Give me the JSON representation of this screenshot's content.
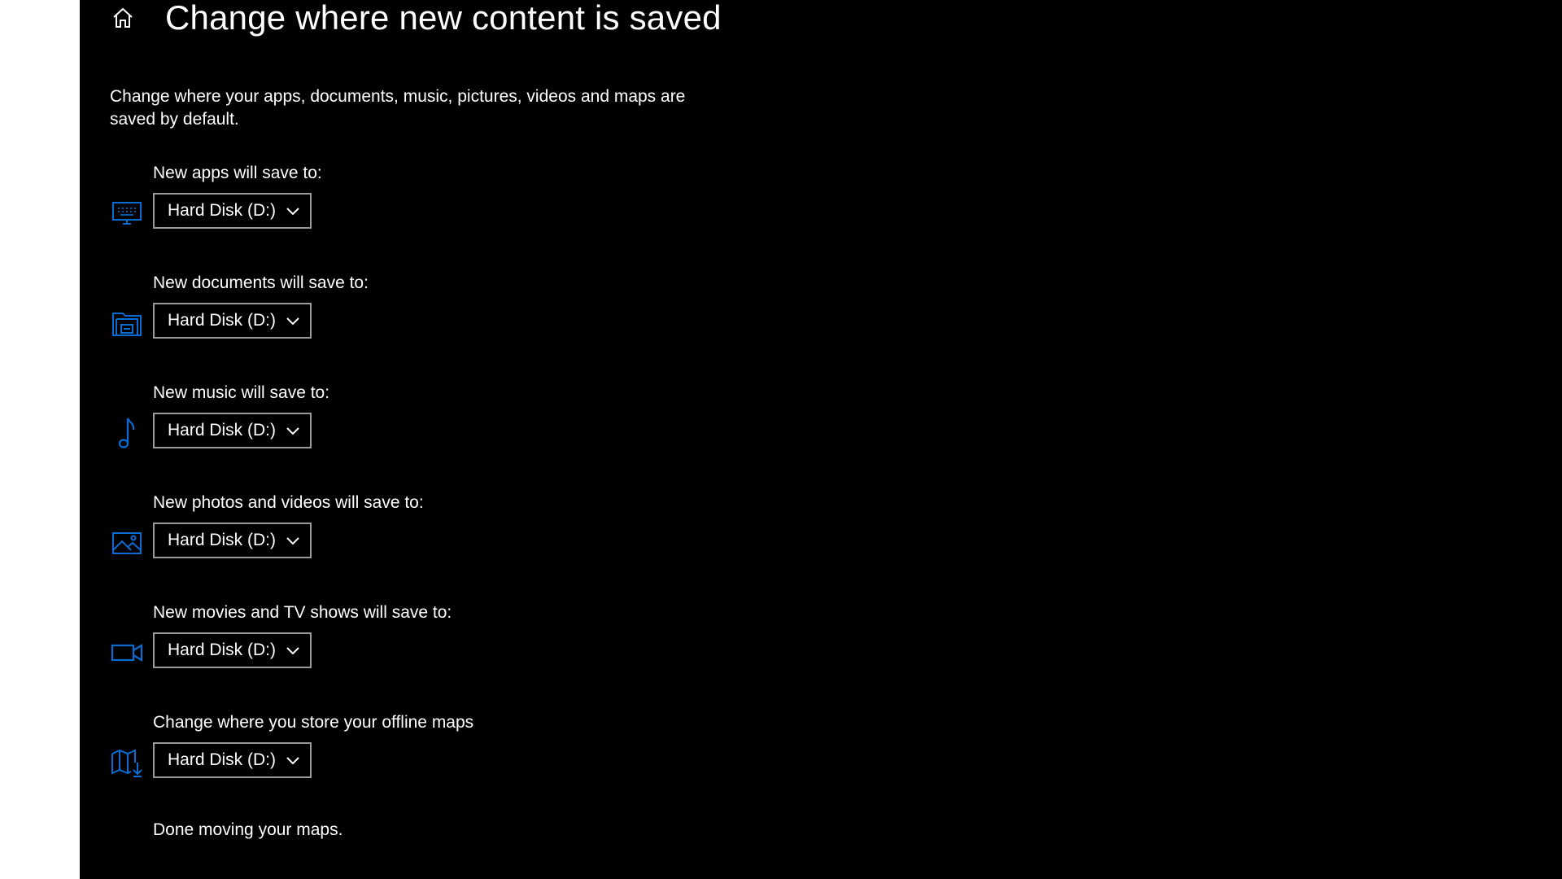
{
  "header": {
    "title": "Change where new content is saved",
    "home_icon": "home-icon"
  },
  "description": "Change where your apps, documents, music, pictures, videos and maps are saved by default.",
  "settings": [
    {
      "label": "New apps will save to:",
      "value": "Hard Disk (D:)",
      "icon": "monitor-keyboard-icon"
    },
    {
      "label": "New documents will save to:",
      "value": "Hard Disk (D:)",
      "icon": "documents-drive-icon"
    },
    {
      "label": "New music will save to:",
      "value": "Hard Disk (D:)",
      "icon": "music-note-icon"
    },
    {
      "label": "New photos and videos will save to:",
      "value": "Hard Disk (D:)",
      "icon": "photo-icon"
    },
    {
      "label": "New movies and TV shows will save to:",
      "value": "Hard Disk (D:)",
      "icon": "video-camera-icon"
    },
    {
      "label": "Change where you store your offline maps",
      "value": "Hard Disk (D:)",
      "icon": "offline-map-icon"
    }
  ],
  "footer": {
    "status": "Done moving your maps."
  },
  "colors": {
    "accent": "#0a6bd1",
    "background": "#000000",
    "text": "#ffffff",
    "dropdown_border": "#9a9a9a"
  }
}
